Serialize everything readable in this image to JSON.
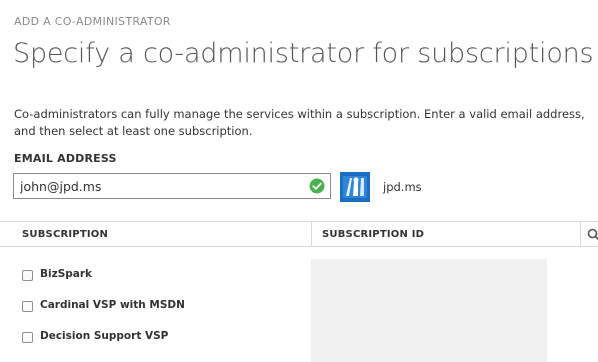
{
  "header": {
    "kicker": "ADD A CO-ADMINISTRATOR",
    "title": "Specify a co-administrator for subscriptions",
    "description": "Co-administrators can fully manage the services within a subscription. Enter a valid email address, and then select at least one subscription."
  },
  "email": {
    "label": "EMAIL ADDRESS",
    "value": "john@jpd.ms",
    "status_icon": "check-circle-icon",
    "status_color": "#4caf50"
  },
  "domain": {
    "logo_icon": "domain-logo-icon",
    "name": "jpd.ms",
    "logo_color": "#1b6ec2"
  },
  "table": {
    "columns": [
      "SUBSCRIPTION",
      "SUBSCRIPTION ID"
    ],
    "search_icon": "search-icon",
    "rows": [
      {
        "label": "BizSpark",
        "checked": false
      },
      {
        "label": "Cardinal VSP with MSDN",
        "checked": false
      },
      {
        "label": "Decision Support VSP",
        "checked": false
      }
    ]
  }
}
